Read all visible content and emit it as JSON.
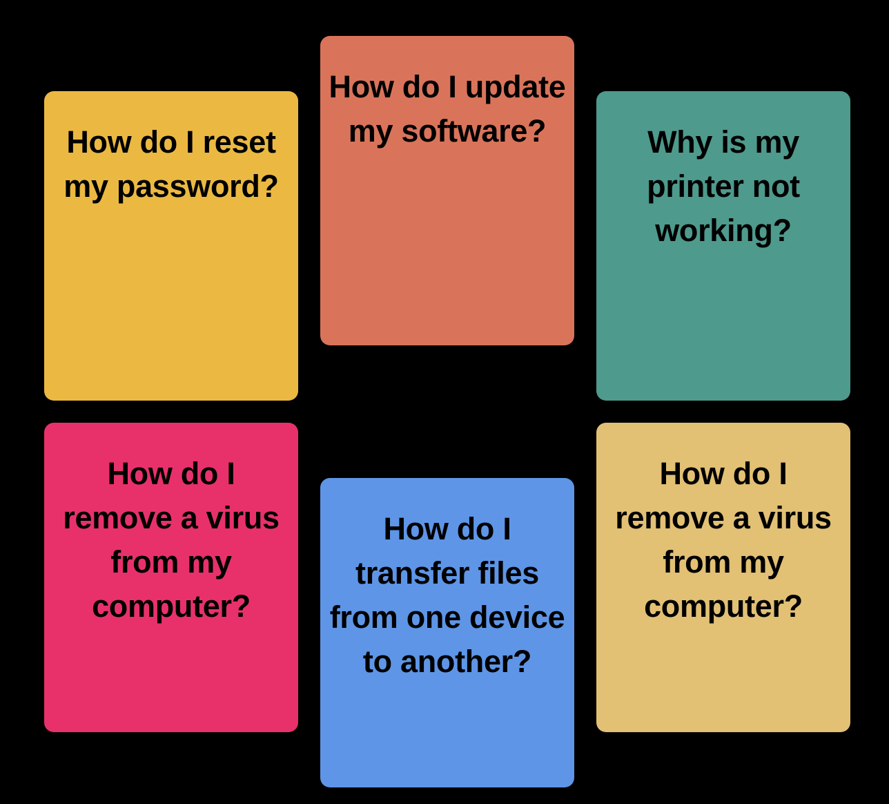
{
  "cards": [
    {
      "text": "How do I reset\nmy password?",
      "color": "#EBB942"
    },
    {
      "text": "How do I update\nmy software?",
      "color": "#D9745B"
    },
    {
      "text": "Why is my\nprinter not\nworking?",
      "color": "#4E9A8D"
    },
    {
      "text": "How do I\nremove a virus\nfrom my\ncomputer?",
      "color": "#E8316B"
    },
    {
      "text": "How do I\ntransfer files\nfrom one device\nto another?",
      "color": "#5E95E6"
    },
    {
      "text": "How do I\nremove a virus\nfrom my\ncomputer?",
      "color": "#E2C074"
    }
  ]
}
